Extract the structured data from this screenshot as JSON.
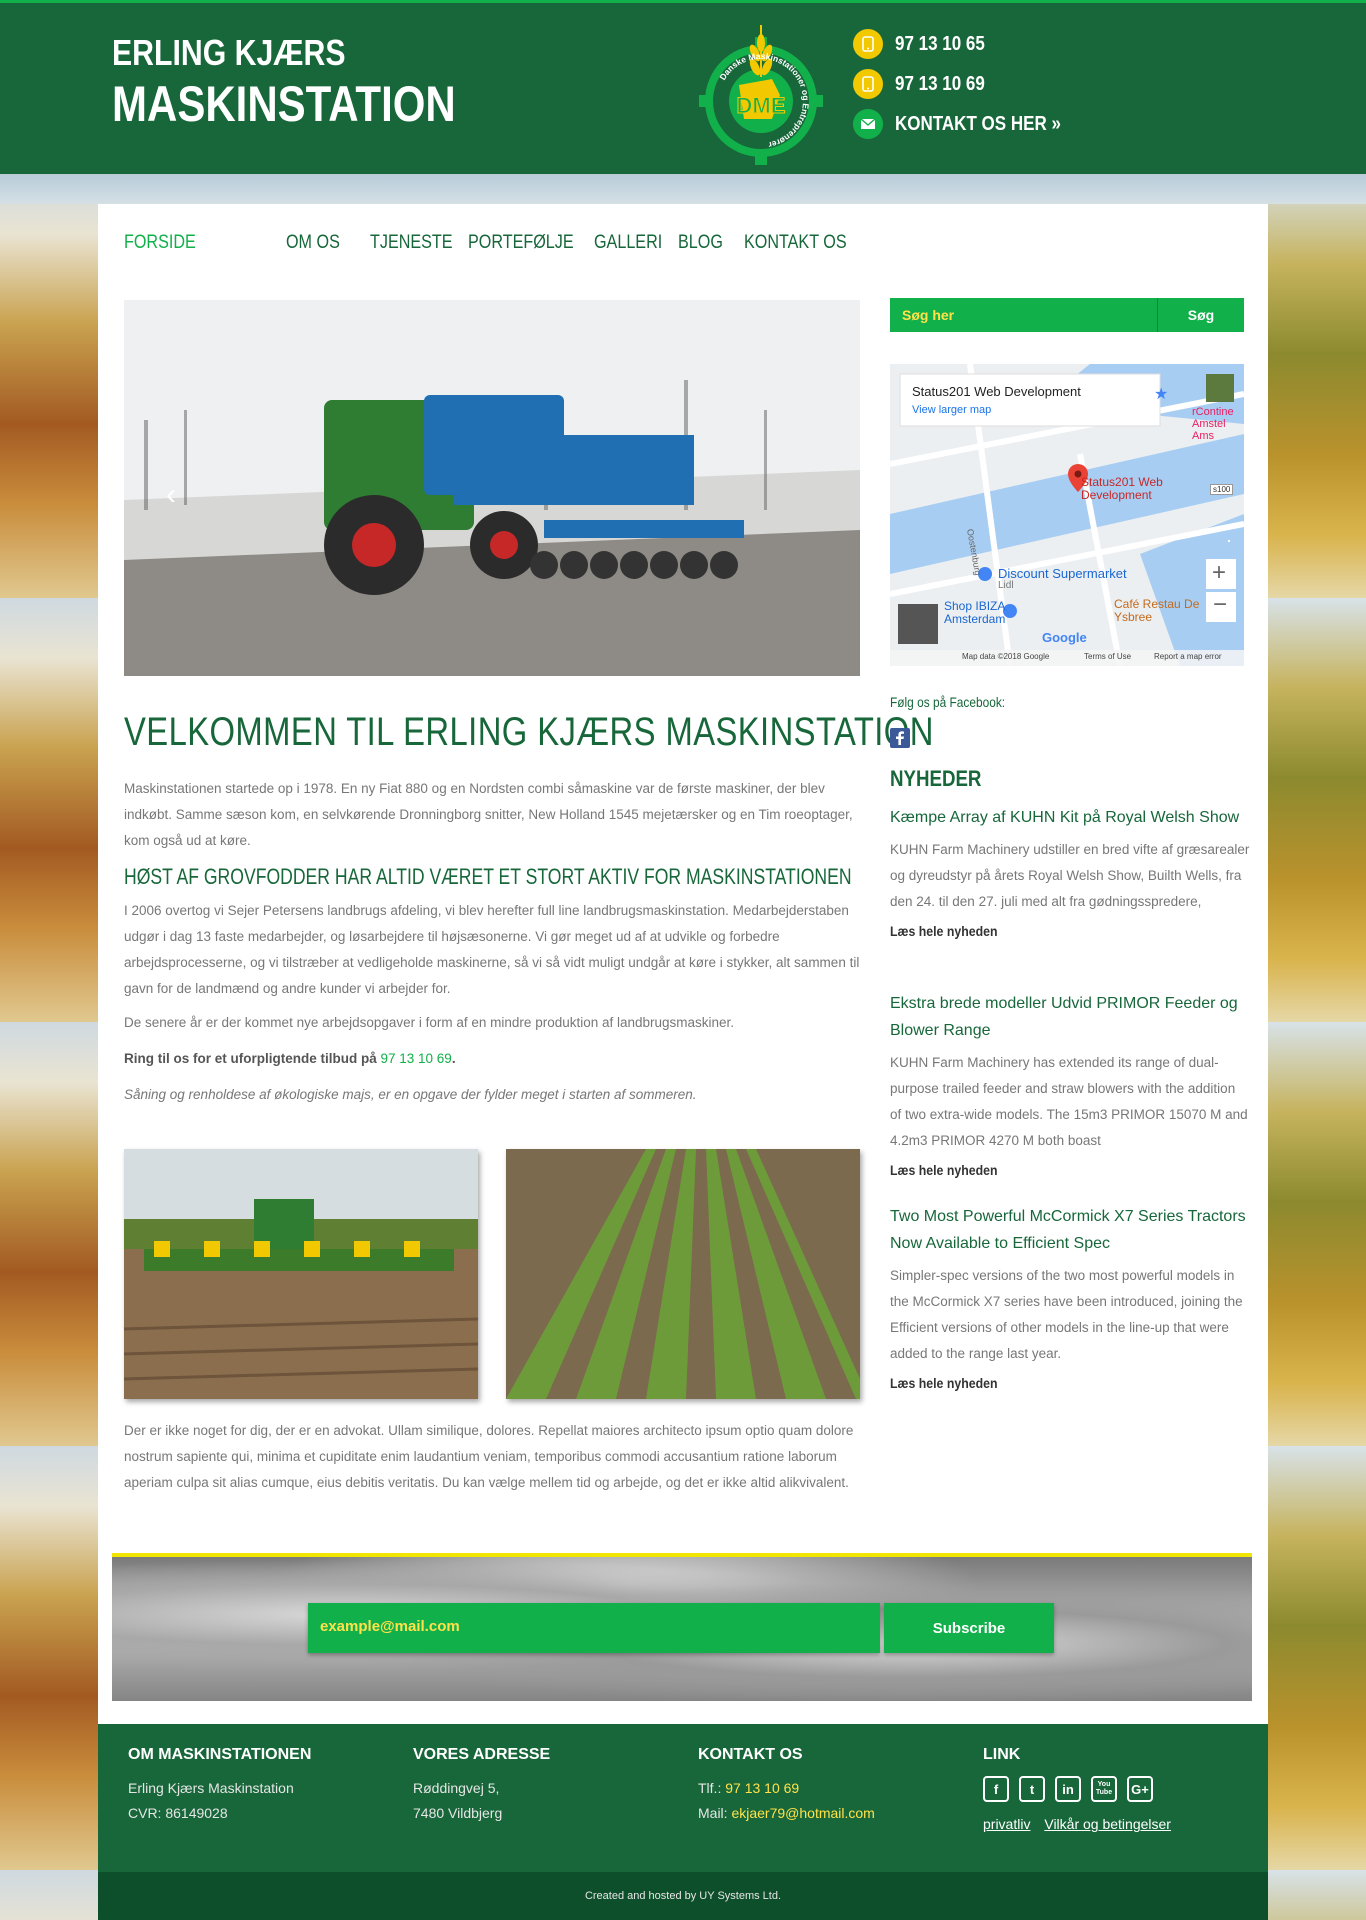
{
  "header": {
    "brand_line1": "ERLING KJÆRS",
    "brand_line2": "MASKINSTATION",
    "logo_text": "DME",
    "logo_ring_text": "Danske Maskinstationer og Entreprenører",
    "phone1": "97 13 10 65",
    "phone2": "97 13 10 69",
    "contact_link": "KONTAKT OS HER »"
  },
  "nav": [
    "FORSIDE",
    "OM OS",
    "TJENESTE",
    "PORTEFØLJE",
    "GALLERI",
    "BLOG",
    "KONTAKT OS"
  ],
  "main": {
    "title": "VELKOMMEN TIL ERLING KJÆRS MASKINSTATION",
    "intro": "Maskinstationen startede op i 1978. En ny Fiat 880 og en Nordsten combi såmaskine var de første maskiner, der blev indkøbt. Samme sæson kom, en selvkørende Dronningborg snitter, New Holland 1545 mejetærsker og en Tim roeoptager, kom også ud at køre.",
    "subtitle": "HØST AF GROVFODDER HAR ALTID VÆRET ET STORT AKTIV FOR MASKINSTATIONEN",
    "para2": "I 2006 overtog vi Sejer Petersens landbrugs afdeling, vi blev herefter full line landbrugsmaskinstation. Medarbejderstaben udgør i dag 13 faste medarbejder, og løsarbejdere til højsæsonerne. Vi gør meget ud af at udvikle og forbedre arbejdsprocesserne, og vi tilstræber at vedligeholde maskinerne, så vi så vidt muligt undgår at køre i stykker, alt sammen til gavn for de landmænd og andre kunder vi arbejder for.",
    "para3": "De senere år er der kommet nye arbejdsopgaver i form af en mindre produktion af landbrugsmaskiner.",
    "call_prefix": "Ring til os for et uforpligtende tilbud på ",
    "call_phone": "97 13 10 69",
    "call_suffix": ".",
    "italic_note": "Såning og renholdese af økologiske majs, er en opgave der fylder meget i starten af sommeren.",
    "para4": "Der er ikke noget for dig, der er en advokat. Ullam similique, dolores. Repellat maiores architecto ipsum optio quam dolore nostrum sapiente qui, minima et cupiditate enim laudantium veniam, temporibus commodi accusantium ratione laborum aperiam culpa sit alias cumque, eius debitis veritatis. Du kan vælge mellem tid og arbejde, og det er ikke altid alikvivalent."
  },
  "sidebar": {
    "search_placeholder": "Søg her",
    "search_button": "Søg",
    "map_title": "Status201 Web Development",
    "map_link": "View larger map",
    "map_pin_label": "Status201 Web Development",
    "map_poi1": "Discount Supermarket",
    "map_poi1_sub": "Lidl",
    "map_poi2": "Café Restau De Ysbree",
    "map_poi3": "Shop IBIZA Amsterdam",
    "map_street": "Oostenburg",
    "map_road_s100": "s100",
    "map_corner": "rContine Amstel Ams",
    "map_footer1": "Map data ©2018 Google",
    "map_footer2": "Terms of Use",
    "map_footer3": "Report a map error",
    "map_google": "Google",
    "follow": "Følg os på Facebook:",
    "news_heading": "NYHEDER",
    "news": [
      {
        "title": "Kæmpe Array af KUHN Kit på Royal Welsh Show",
        "desc": "KUHN Farm Machinery udstiller en bred vifte af græsarealer og dyreudstyr på årets Royal Welsh Show, Builth Wells, fra den 24. til den 27. juli med alt fra gødningsspredere,",
        "more": "Læs hele nyheden"
      },
      {
        "title": "Ekstra brede modeller Udvid PRIMOR Feeder og Blower Range",
        "desc": "KUHN Farm Machinery has extended its range of dual-purpose trailed feeder and straw blowers with the addition of two extra-wide models. The 15m3 PRIMOR 15070 M and 4.2m3 PRIMOR 4270 M both boast",
        "more": "Læs hele nyheden"
      },
      {
        "title": "Two Most Powerful McCormick X7 Series Tractors Now Available to Efficient Spec",
        "desc": "Simpler-spec versions of the two most powerful models in the McCormick X7 series have been introduced, joining the Efficient versions of other models in the line-up that were added to the range last year.",
        "more": "Læs hele nyheden"
      }
    ]
  },
  "subscribe": {
    "placeholder": "example@mail.com",
    "button": "Subscribe"
  },
  "footer": {
    "col1_title": "OM MASKINSTATIONEN",
    "col1_line1": "Erling Kjærs Maskinstation",
    "col1_line2": "CVR: 86149028",
    "col2_title": "VORES ADRESSE",
    "col2_line1": "Røddingvej 5,",
    "col2_line2": "7480 Vildbjerg",
    "col3_title": "KONTAKT OS",
    "col3_phone_label": "Tlf.: ",
    "col3_phone": "97 13 10 69",
    "col3_mail_label": "Mail: ",
    "col3_mail": "ekjaer79@hotmail.com",
    "col4_title": "LINK",
    "social": [
      "f",
      "t",
      "in",
      "You Tube",
      "G+"
    ],
    "link1": "privatliv",
    "link2": "Vilkår og betingelser",
    "copyright": "Created and hosted by UY Systems Ltd."
  },
  "colors": {
    "brand_green": "#17673a",
    "accent_green": "#12b04a",
    "accent_yellow": "#ffe24a"
  }
}
